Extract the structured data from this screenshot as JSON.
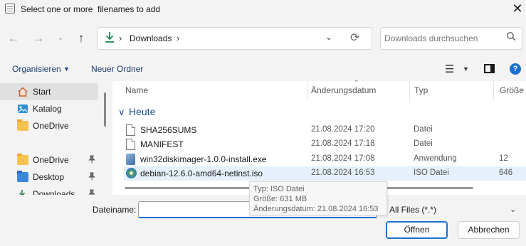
{
  "window": {
    "title": "Select one or more  filenames to add",
    "close_glyph": "✕"
  },
  "nav": {
    "back_glyph": "←",
    "forward_glyph": "→",
    "recent_glyph": "⌄",
    "up_glyph": "↑",
    "address_current": "Downloads",
    "address_sep": "›",
    "address_chevron": "⌄",
    "refresh_glyph": "⟳",
    "search_placeholder": "Downloads durchsuchen",
    "search_glyph": "⌕"
  },
  "toolbar": {
    "organize_label": "Organisieren",
    "organize_caret": "▼",
    "new_folder_label": "Neuer Ordner",
    "view_glyph": "☰",
    "view_caret": "▼",
    "help_glyph": "?"
  },
  "sidebar": {
    "items": [
      {
        "label": "Start",
        "icon": "home-icon",
        "pinned": false,
        "selected": true
      },
      {
        "label": "Katalog",
        "icon": "gallery-icon",
        "pinned": false
      },
      {
        "label": "OneDrive",
        "icon": "folder-icon",
        "pinned": false
      },
      {
        "label": "OneDrive",
        "icon": "folder-icon",
        "pinned": true
      },
      {
        "label": "Desktop",
        "icon": "desktop-icon",
        "pinned": true
      },
      {
        "label": "Downloads",
        "icon": "download-icon",
        "pinned": true
      }
    ],
    "pin_glyph": "📌"
  },
  "file_list": {
    "columns": {
      "name": "Name",
      "date": "Änderungsdatum",
      "type": "Typ",
      "size": "Größe"
    },
    "group_label": "Heute",
    "group_caret": "∨",
    "rows": [
      {
        "name": "SHA256SUMS",
        "date": "21.08.2024 17:20",
        "type": "Datei",
        "size": "",
        "icon": "document-icon"
      },
      {
        "name": "MANIFEST",
        "date": "21.08.2024 17:18",
        "type": "Datei",
        "size": "",
        "icon": "document-icon"
      },
      {
        "name": "win32diskimager-1.0.0-install.exe",
        "date": "21.08.2024 17:08",
        "type": "Anwendung",
        "size": "12",
        "icon": "installer-icon"
      },
      {
        "name": "debian-12.6.0-amd64-netinst.iso",
        "date": "21.08.2024 16:53",
        "type": "ISO Datei",
        "size": "646",
        "icon": "disc-image-icon",
        "hovered": true
      }
    ]
  },
  "tooltip": {
    "line1": "Typ: ISO Datei",
    "line2": "Größe: 631 MB",
    "line3": "Änderungsdatum: 21.08.2024 16:53"
  },
  "footer": {
    "filename_label": "Dateiname:",
    "filename_value": "",
    "filter_value": "All Files (*.*)",
    "filter_caret": "⌄",
    "open_label": "Öffnen",
    "cancel_label": "Abbrechen"
  },
  "colors": {
    "accent": "#1a6fd1",
    "selection": "#e5f0fb",
    "link": "#1a3c6e"
  }
}
